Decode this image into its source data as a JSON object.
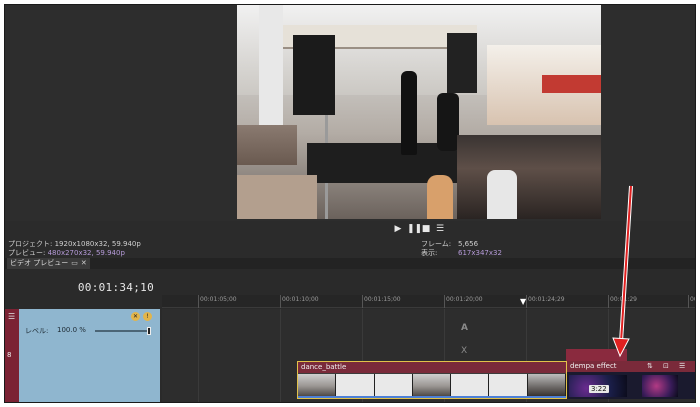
{
  "preview": {
    "project_label": "プロジェクト:",
    "project_value": "1920x1080x32, 59.940p",
    "preview_label": "プレビュー:",
    "preview_value": "480x270x32, 59.940p",
    "frame_label": "フレーム:",
    "frame_value": "5,656",
    "display_label": "表示:",
    "display_value": "617x347x32"
  },
  "transport": {
    "play_icon": "play-icon",
    "pause_icon": "pause-icon",
    "stop_icon": "stop-icon",
    "menu_icon": "menu-icon"
  },
  "tabbar": {
    "tab_label": "ビデオ プレビュー"
  },
  "timeline": {
    "timecode": "00:01:34;10",
    "ruler_ticks": [
      "00:01:05;00",
      "00:01:10;00",
      "00:01:15;00",
      "00:01:20;00",
      "00:01:24;29",
      "00:01:29",
      "00"
    ],
    "empty_track_a": "A",
    "empty_track_x": "X"
  },
  "track": {
    "number": "8",
    "level_label": "レベル:",
    "level_value": "100.0 %",
    "level": 1.0
  },
  "clips": {
    "dance_label": "dance_battle",
    "effect_label": "dempa effect",
    "effect_time": "3:22"
  },
  "colors": {
    "track_stripe": "#7b2233",
    "track_body": "#8fb6cf",
    "clip_header": "#7a2a3a",
    "clip_border": "#e1c24a",
    "annotation_arrow": "#e02020"
  }
}
